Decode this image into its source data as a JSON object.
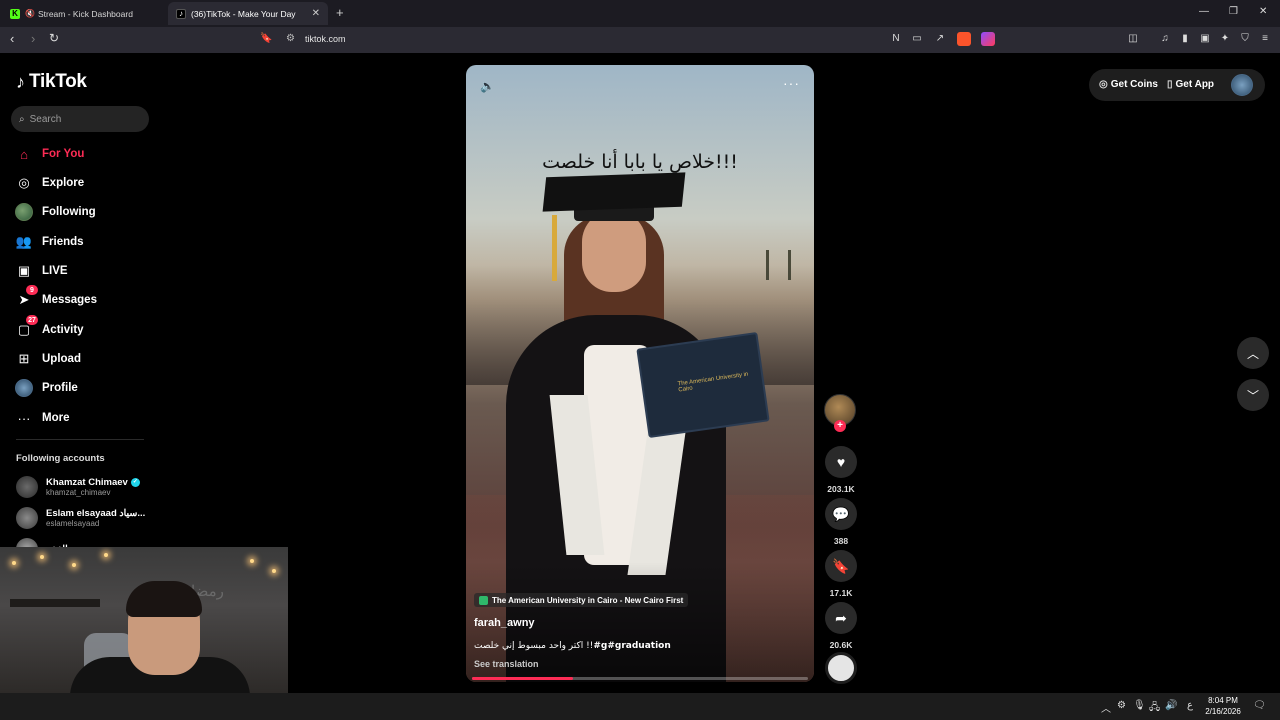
{
  "browser": {
    "tabs": [
      {
        "title": "Stream - Kick Dashboard",
        "favicon": "kick-icon",
        "active": false
      },
      {
        "title": "(36)TikTok - Make Your Day",
        "favicon": "tiktok-icon",
        "active": true
      }
    ],
    "url": "tiktok.com"
  },
  "sidebar": {
    "logo": "TikTok",
    "search_placeholder": "Search",
    "items": [
      {
        "label": "For You",
        "icon": "home-icon",
        "active": true
      },
      {
        "label": "Explore",
        "icon": "compass-icon"
      },
      {
        "label": "Following",
        "icon": "following-avatar"
      },
      {
        "label": "Friends",
        "icon": "friends-icon"
      },
      {
        "label": "LIVE",
        "icon": "live-icon"
      },
      {
        "label": "Messages",
        "icon": "messages-icon",
        "badge": "9"
      },
      {
        "label": "Activity",
        "icon": "activity-icon",
        "badge": "27"
      },
      {
        "label": "Upload",
        "icon": "upload-icon"
      },
      {
        "label": "Profile",
        "icon": "profile-avatar"
      },
      {
        "label": "More",
        "icon": "more-icon"
      }
    ],
    "following_title": "Following accounts",
    "accounts": [
      {
        "name": "Khamzat Chimaev",
        "handle": "khamzat_chimaev",
        "verified": true
      },
      {
        "name": "Eslam elsayaad سياد...",
        "handle": "eslamelsayaad"
      },
      {
        "name": "الفخر",
        "handle": ""
      }
    ]
  },
  "webcam": {
    "wall_text": "رمضان"
  },
  "video": {
    "overlay_text": "خلاص يا بابا أنا خلصت!!!",
    "location": "The American University in Cairo - New Cairo First",
    "diploma_text": "The American University in Cairo",
    "username": "farah_awny",
    "description_prefix": "اكتر واحد مبسوط إني خلصت !!",
    "description_tags": "#g#graduation",
    "see_translation": "See translation",
    "progress": 0.3
  },
  "actions": {
    "likes": "203.1K",
    "comments": "388",
    "saves": "17.1K",
    "shares": "20.6K"
  },
  "topbar": {
    "get_coins": "Get Coins",
    "get_app": "Get App"
  },
  "taskbar": {
    "time": "8:04 PM",
    "date": "2/16/2026",
    "lang": "ع"
  },
  "colors": {
    "accent": "#fe2c55",
    "background": "#000000",
    "sidebar_search": "#242424"
  }
}
